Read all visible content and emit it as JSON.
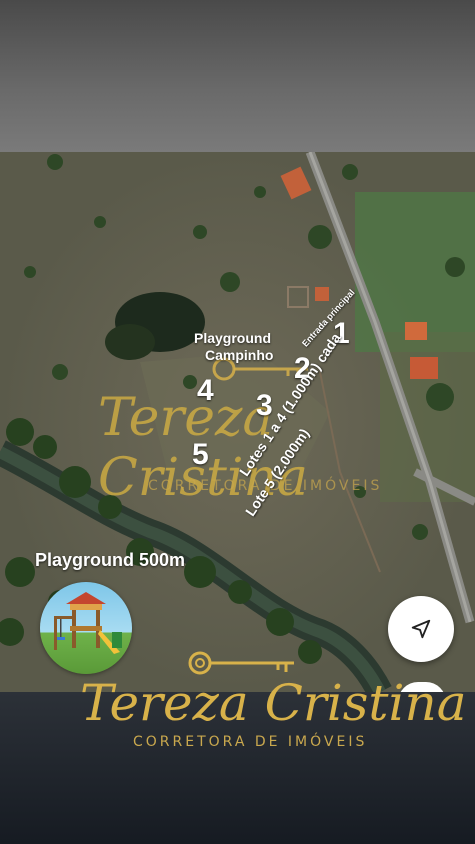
{
  "map": {
    "label_playground": "Playground",
    "label_campinho": "Campinho",
    "label_entrance": "Entrada principal",
    "lot_numbers": [
      "1",
      "2",
      "3",
      "4",
      "5"
    ],
    "lots_text_1": "Lotes 1 a 4 (1.000m) cada",
    "lots_text_2": "Lote 5 (2.000m)",
    "playground_distance": "Playground 500m"
  },
  "watermark_map": {
    "name": "Tereza Cristina",
    "subtitle": "CORRETORA DE IMÓVEIS"
  },
  "brand": {
    "name": "Tereza Cristina",
    "subtitle": "CORRETORA DE IMÓVEIS",
    "gold": "#d8b24a",
    "subtitle_color": "#c9a84e"
  },
  "controls": {
    "navigation_icon": "navigation-arrow-icon"
  }
}
